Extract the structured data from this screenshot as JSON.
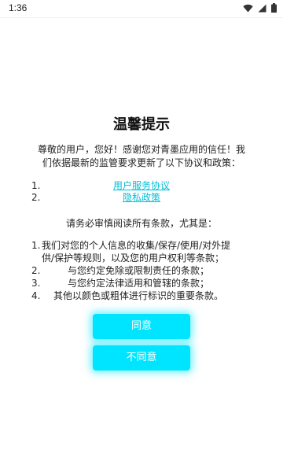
{
  "status_bar": {
    "time": "1:36",
    "icons": [
      "wifi-icon",
      "signal-icon",
      "battery-icon"
    ]
  },
  "dialog": {
    "title": "温馨提示",
    "intro": "尊敬的用户，您好！感谢您对青墨应用的信任！我们依据最新的监管要求更新了以下协议和政策：",
    "documents": [
      {
        "number": "1.",
        "label": "用户服务协议"
      },
      {
        "number": "2.",
        "label": "隐私政策"
      }
    ],
    "requirement": "请务必审慎阅读所有条款，尤其是：",
    "terms": [
      {
        "number": "1.",
        "text": "我们对您的个人信息的收集/保存/使用/对外提供/保护等规则，以及您的用户权利等条款；"
      },
      {
        "number": "2.",
        "text": "与您约定免除或限制责任的条款；"
      },
      {
        "number": "3.",
        "text": "与您约定法律适用和管辖的条款；"
      },
      {
        "number": "4.",
        "text": "其他以颜色或粗体进行标识的重要条款。"
      }
    ],
    "agree_label": "同意",
    "disagree_label": "不同意"
  },
  "colors": {
    "accent": "#00E5FF",
    "link": "#00BFD8",
    "background": "#FFFFFF"
  }
}
